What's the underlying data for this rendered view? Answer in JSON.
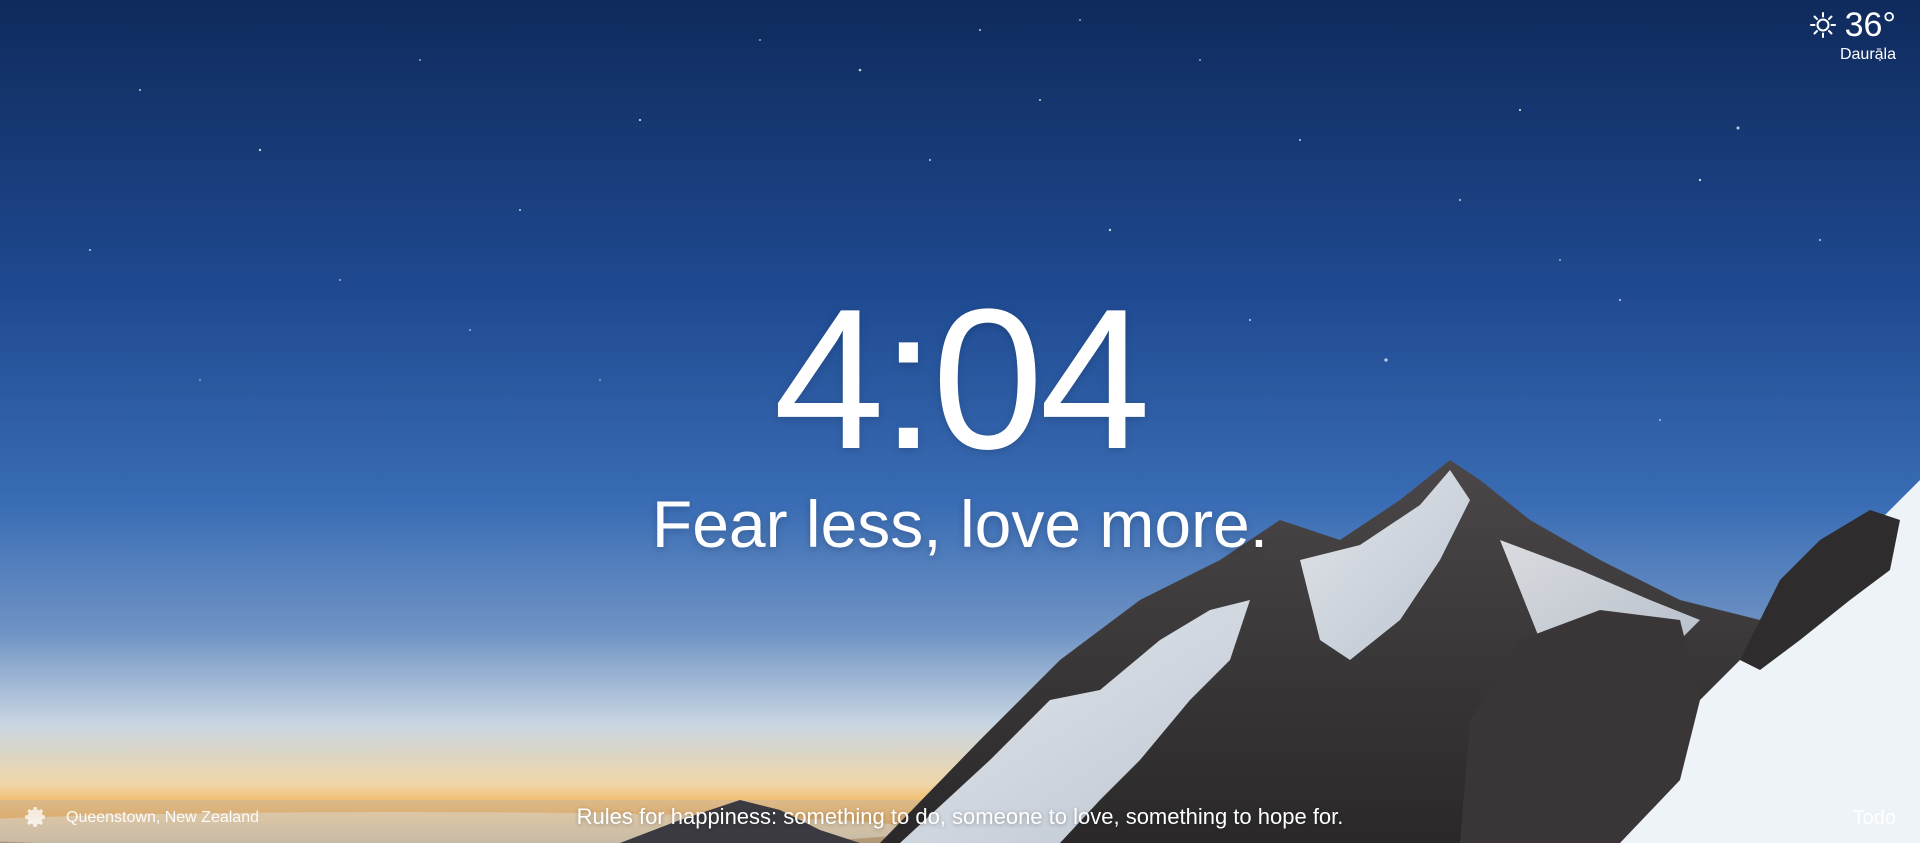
{
  "weather": {
    "icon": "sun-icon",
    "temperature": "36°",
    "location": "Daurāla"
  },
  "clock": {
    "time": "4:04"
  },
  "greeting": {
    "text": "Fear less, love more."
  },
  "footer": {
    "settings_icon": "gear-icon",
    "photo_location": "Queenstown, New Zealand",
    "quote": "Rules for happiness: something to do, someone to love, something to hope for.",
    "todo_label": "Todo"
  },
  "background": {
    "description_colors": {
      "sky_top": "#0f2a5c",
      "sky_mid": "#2f5fa8",
      "sky_horizon": "#9fb6cf",
      "sunset_glow": "#f2a33a",
      "snow": "#e8eef6",
      "rock": "#3b3a3c"
    }
  }
}
